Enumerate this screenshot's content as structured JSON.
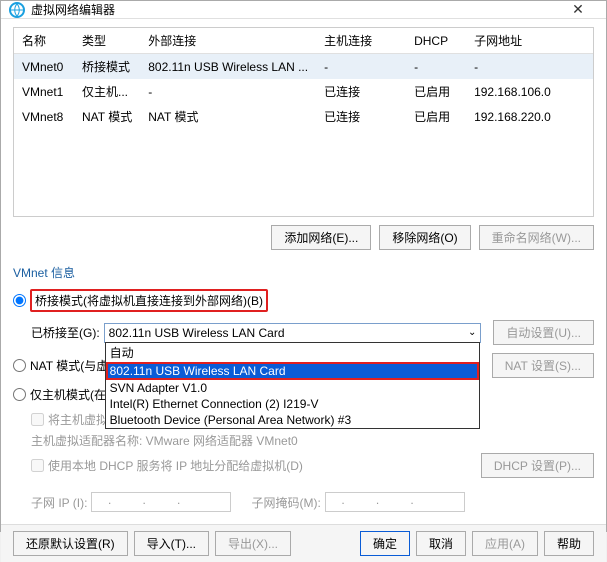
{
  "window": {
    "title": "虚拟网络编辑器"
  },
  "table": {
    "headers": {
      "name": "名称",
      "type": "类型",
      "ext": "外部连接",
      "host": "主机连接",
      "dhcp": "DHCP",
      "subnet": "子网地址"
    },
    "rows": [
      {
        "name": "VMnet0",
        "type": "桥接模式",
        "ext": "802.11n USB Wireless LAN ...",
        "host": "-",
        "dhcp": "-",
        "subnet": "-"
      },
      {
        "name": "VMnet1",
        "type": "仅主机...",
        "ext": "-",
        "host": "已连接",
        "dhcp": "已启用",
        "subnet": "192.168.106.0"
      },
      {
        "name": "VMnet8",
        "type": "NAT 模式",
        "ext": "NAT 模式",
        "host": "已连接",
        "dhcp": "已启用",
        "subnet": "192.168.220.0"
      }
    ]
  },
  "buttons": {
    "add_network": "添加网络(E)...",
    "remove_network": "移除网络(O)",
    "rename_network": "重命名网络(W)..."
  },
  "vmnet_info": {
    "label": "VMnet 信息",
    "bridge_radio": "桥接模式(将虚拟机直接连接到外部网络)(B)",
    "bridge_to": "已桥接至(G):",
    "combo_value": "802.11n USB Wireless LAN Card",
    "auto_settings": "自动设置(U)...",
    "dropdown": {
      "opt0": "自动",
      "opt1": "802.11n USB Wireless LAN Card",
      "opt2": "SVN Adapter V1.0",
      "opt3": "Intel(R) Ethernet Connection (2) I219-V",
      "opt4": "Bluetooth Device (Personal Area Network) #3"
    },
    "nat_radio": "NAT 模式(与虚",
    "nat_settings": "NAT 设置(S)...",
    "hostonly_radio": "仅主机模式(在",
    "connect_host": "将主机虚拟适配器连接到此网络(V)",
    "host_adapter_label": "主机虚拟适配器名称: VMware 网络适配器 VMnet0",
    "use_dhcp": "使用本地 DHCP 服务将 IP 地址分配给虚拟机(D)",
    "dhcp_settings": "DHCP 设置(P)...",
    "subnet_ip": "子网 IP (I):",
    "subnet_mask": "子网掩码(M):"
  },
  "footer": {
    "restore": "还原默认设置(R)",
    "import": "导入(T)...",
    "export": "导出(X)...",
    "ok": "确定",
    "cancel": "取消",
    "apply": "应用(A)",
    "help": "帮助"
  }
}
